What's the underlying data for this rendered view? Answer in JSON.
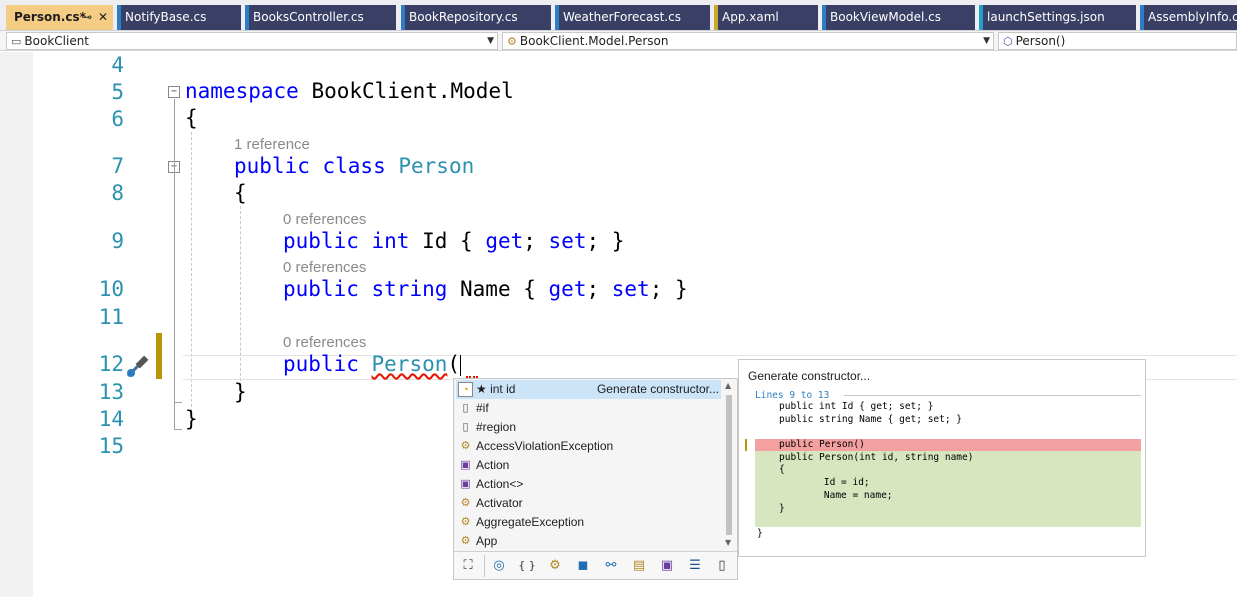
{
  "tabs": [
    {
      "label": "Person.cs*",
      "pin": "⊸",
      "close": "✕",
      "active": true
    },
    {
      "label": "NotifyBase.cs"
    },
    {
      "label": "BooksController.cs"
    },
    {
      "label": "BookRepository.cs"
    },
    {
      "label": "WeatherForecast.cs"
    },
    {
      "label": "App.xaml"
    },
    {
      "label": "BookViewModel.cs"
    },
    {
      "label": "launchSettings.json"
    },
    {
      "label": "AssemblyInfo.cs"
    }
  ],
  "colors": {
    "tab_background": "#3a3f66",
    "active_tab": "#f5cc84",
    "stripe_cs": "#2d7ec6",
    "stripe_xaml": "#c9a82c",
    "stripe_json": "#1fa1c9",
    "keyword": "#0000ff",
    "type": "#2b91af",
    "line_number": "#2b91af",
    "change_marker": "#b8960a",
    "selection": "#cce4f7",
    "removed_line": "#f4a0a0",
    "added_lines": "#d8e6c0"
  },
  "navbar": {
    "project": "BookClient",
    "type": "BookClient.Model.Person",
    "member": "Person()"
  },
  "editor": {
    "lines": [
      "4",
      "5",
      "6",
      "7",
      "8",
      "9",
      "10",
      "11",
      "12",
      "13",
      "14",
      "15"
    ],
    "code": {
      "ns_kw": "namespace",
      "ns_name": " BookClient.Model",
      "open_brace": "{",
      "class_mods": "public class",
      "class_name": "Person",
      "id_public": "public",
      "id_type": "int",
      "id_name": " Id { ",
      "get": "get",
      "set": "set",
      "semi_space": "; ",
      "semi_close": "; }",
      "name_public": "public",
      "name_type": "string",
      "name_name": " Name { ",
      "ctor_public": "public",
      "ctor_name": "Person",
      "ctor_paren": "(",
      "close_class": "}",
      "close_ns": "}"
    },
    "codelens": {
      "class": "1 reference",
      "id": "0 references",
      "name": "0 references",
      "ctor": "0 references"
    }
  },
  "completion": {
    "items": [
      {
        "icon": "lightbulb-icon",
        "glyph": "💡",
        "label": "★ int id",
        "hint": "Generate constructor..."
      },
      {
        "icon": "snippet-icon",
        "glyph": "▯",
        "label": "#if"
      },
      {
        "icon": "snippet-icon",
        "glyph": "▯",
        "label": "#region"
      },
      {
        "icon": "class-icon",
        "glyph": "⚙",
        "label": "AccessViolationException"
      },
      {
        "icon": "delegate-icon",
        "glyph": "▣",
        "label": "Action"
      },
      {
        "icon": "delegate-icon",
        "glyph": "▣",
        "label": "Action<>"
      },
      {
        "icon": "class-icon",
        "glyph": "⚙",
        "label": "Activator"
      },
      {
        "icon": "class-icon",
        "glyph": "⚙",
        "label": "AggregateException"
      },
      {
        "icon": "class-icon",
        "glyph": "⚙",
        "label": "App"
      }
    ],
    "filters": [
      "expand-icon",
      "lightbulb-filter-icon",
      "namespace-filter-icon",
      "class-filter-icon",
      "struct-filter-icon",
      "interface-filter-icon",
      "enum-filter-icon",
      "delegate-filter-icon",
      "module-filter-icon",
      "snippet-filter-icon"
    ]
  },
  "preview": {
    "title": "Generate constructor...",
    "range": "Lines 9 to 13",
    "lines": [
      "public int Id { get; set; }",
      "public string Name { get; set; }",
      "",
      "public Person()",
      "public Person(int id, string name)",
      "{",
      "    Id = id;",
      "    Name = name;",
      "}",
      "}"
    ]
  }
}
